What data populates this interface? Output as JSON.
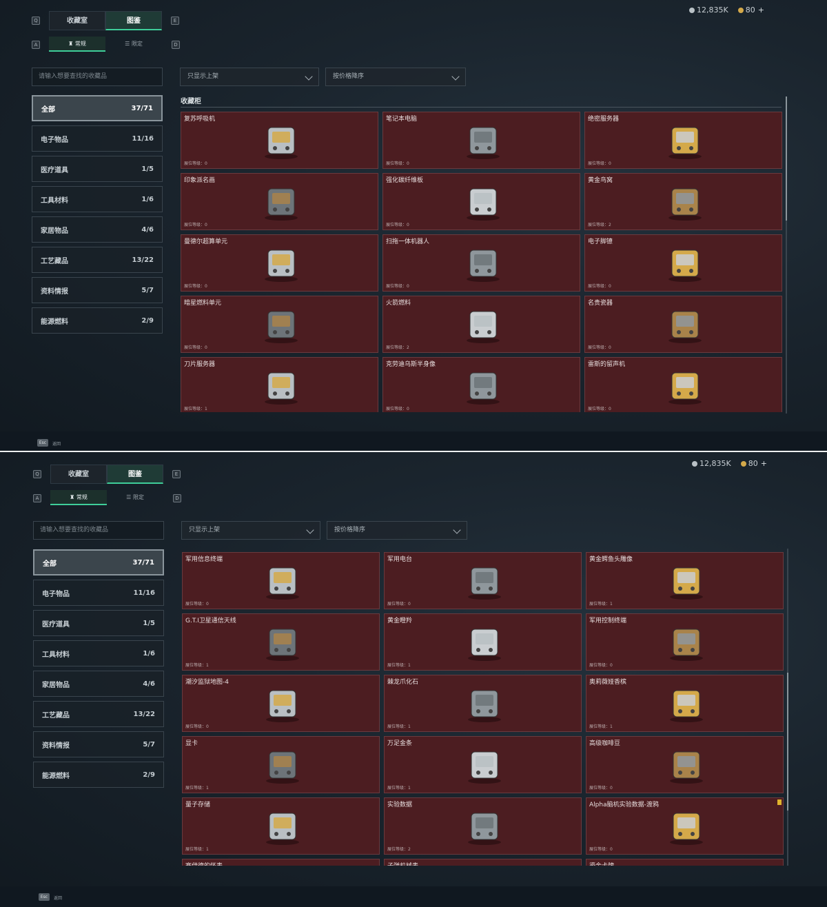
{
  "screens": [
    {
      "currency": {
        "silver": "12,835K",
        "gold": "80",
        "plus": "+"
      },
      "tabs": {
        "key_left": "Q",
        "collection": "收藏室",
        "atlas": "图鉴",
        "key_right": "E"
      },
      "subtabs": {
        "key_left": "A",
        "normal": "常规",
        "limited": "限定",
        "key_right": "D"
      },
      "search_placeholder": "请输入想要查找的收藏品",
      "filters": {
        "show": "只显示上架",
        "sort": "按价格降序"
      },
      "section_title": "收藏柜",
      "categories": [
        {
          "label": "全部",
          "count": "37/71"
        },
        {
          "label": "电子物品",
          "count": "11/16"
        },
        {
          "label": "医疗道具",
          "count": "1/5"
        },
        {
          "label": "工具材料",
          "count": "1/6"
        },
        {
          "label": "家居物品",
          "count": "4/6"
        },
        {
          "label": "工艺藏品",
          "count": "13/22"
        },
        {
          "label": "资料情报",
          "count": "5/7"
        },
        {
          "label": "能源燃料",
          "count": "2/9"
        }
      ],
      "items": [
        {
          "name": "复苏呼吸机",
          "level": "展位等级：0",
          "icon": "ventilator-icon"
        },
        {
          "name": "笔记本电脑",
          "level": "展位等级：0",
          "icon": "laptop-icon"
        },
        {
          "name": "绝密服务器",
          "level": "展位等级：0",
          "icon": "server-icon"
        },
        {
          "name": "印象派名画",
          "level": "展位等级：0",
          "icon": "painting-icon"
        },
        {
          "name": "强化碳纤维板",
          "level": "展位等级：0",
          "icon": "carbon-plate-icon"
        },
        {
          "name": "黄金鸟窝",
          "level": "展位等级：2",
          "icon": "golden-nest-icon"
        },
        {
          "name": "曼德尔超算单元",
          "level": "展位等级：0",
          "icon": "cpu-unit-icon"
        },
        {
          "name": "扫拖一体机器人",
          "level": "展位等级：0",
          "icon": "robot-vacuum-icon"
        },
        {
          "name": "电子脚镣",
          "level": "展位等级：0",
          "icon": "ankle-monitor-icon"
        },
        {
          "name": "暗星燃料单元",
          "level": "展位等级：0",
          "icon": "fuel-cell-icon"
        },
        {
          "name": "火箭燃料",
          "level": "展位等级：2",
          "icon": "fuel-can-icon"
        },
        {
          "name": "名贵瓷器",
          "level": "展位等级：0",
          "icon": "porcelain-vase-icon"
        },
        {
          "name": "刀片服务器",
          "level": "展位等级：1",
          "icon": "blade-server-icon"
        },
        {
          "name": "克劳迪乌斯半身像",
          "level": "展位等级：0",
          "icon": "bust-icon"
        },
        {
          "name": "雷斯的留声机",
          "level": "展位等级：0",
          "icon": "gramophone-icon"
        }
      ],
      "esc": {
        "key": "Esc",
        "label": "返回"
      }
    },
    {
      "currency": {
        "silver": "12,835K",
        "gold": "80",
        "plus": "+"
      },
      "tabs": {
        "key_left": "Q",
        "collection": "收藏室",
        "atlas": "图鉴",
        "key_right": "E"
      },
      "subtabs": {
        "key_left": "A",
        "normal": "常规",
        "limited": "限定",
        "key_right": "D"
      },
      "search_placeholder": "请输入想要查找的收藏品",
      "filters": {
        "show": "只显示上架",
        "sort": "按价格降序"
      },
      "categories": [
        {
          "label": "全部",
          "count": "37/71"
        },
        {
          "label": "电子物品",
          "count": "11/16"
        },
        {
          "label": "医疗道具",
          "count": "1/5"
        },
        {
          "label": "工具材料",
          "count": "1/6"
        },
        {
          "label": "家居物品",
          "count": "4/6"
        },
        {
          "label": "工艺藏品",
          "count": "13/22"
        },
        {
          "label": "资料情报",
          "count": "5/7"
        },
        {
          "label": "能源燃料",
          "count": "2/9"
        }
      ],
      "items": [
        {
          "name": "军用信息终端",
          "level": "展位等级：0",
          "icon": "rugged-terminal-icon"
        },
        {
          "name": "军用电台",
          "level": "展位等级：0",
          "icon": "military-radio-icon"
        },
        {
          "name": "黄金鳄鱼头雕像",
          "level": "展位等级：1",
          "icon": "golden-crocodile-icon"
        },
        {
          "name": "G.T.I卫星通信天线",
          "level": "展位等级：1",
          "icon": "satellite-dish-icon"
        },
        {
          "name": "黄金瞪羚",
          "level": "展位等级：1",
          "icon": "golden-gazelle-icon"
        },
        {
          "name": "军用控制终端",
          "level": "展位等级：0",
          "icon": "control-terminal-icon"
        },
        {
          "name": "潮汐监狱地图-4",
          "level": "展位等级：0",
          "icon": "map-icon"
        },
        {
          "name": "棘龙爪化石",
          "level": "展位等级：1",
          "icon": "claw-fossil-icon"
        },
        {
          "name": "奥莉薇娅香槟",
          "level": "展位等级：1",
          "icon": "champagne-icon"
        },
        {
          "name": "显卡",
          "level": "展位等级：1",
          "icon": "gpu-icon"
        },
        {
          "name": "万足金条",
          "level": "展位等级：1",
          "icon": "gold-bar-icon"
        },
        {
          "name": "高级咖啡豆",
          "level": "展位等级：0",
          "icon": "coffee-bag-icon"
        },
        {
          "name": "量子存储",
          "level": "展位等级：1",
          "icon": "quantum-storage-icon"
        },
        {
          "name": "实验数据",
          "level": "展位等级：2",
          "icon": "disc-icon"
        },
        {
          "name": "Alpha脑机实验数据-渡鸦",
          "level": "展位等级：0",
          "icon": "bci-data-icon",
          "flag": true
        },
        {
          "name": "赛伊德的怀表",
          "level": "",
          "icon": ""
        },
        {
          "name": "子弹机械表",
          "level": "",
          "icon": ""
        },
        {
          "name": "鎏金卡牌",
          "level": "",
          "icon": ""
        }
      ],
      "esc": {
        "key": "Esc",
        "label": "返回"
      }
    }
  ]
}
